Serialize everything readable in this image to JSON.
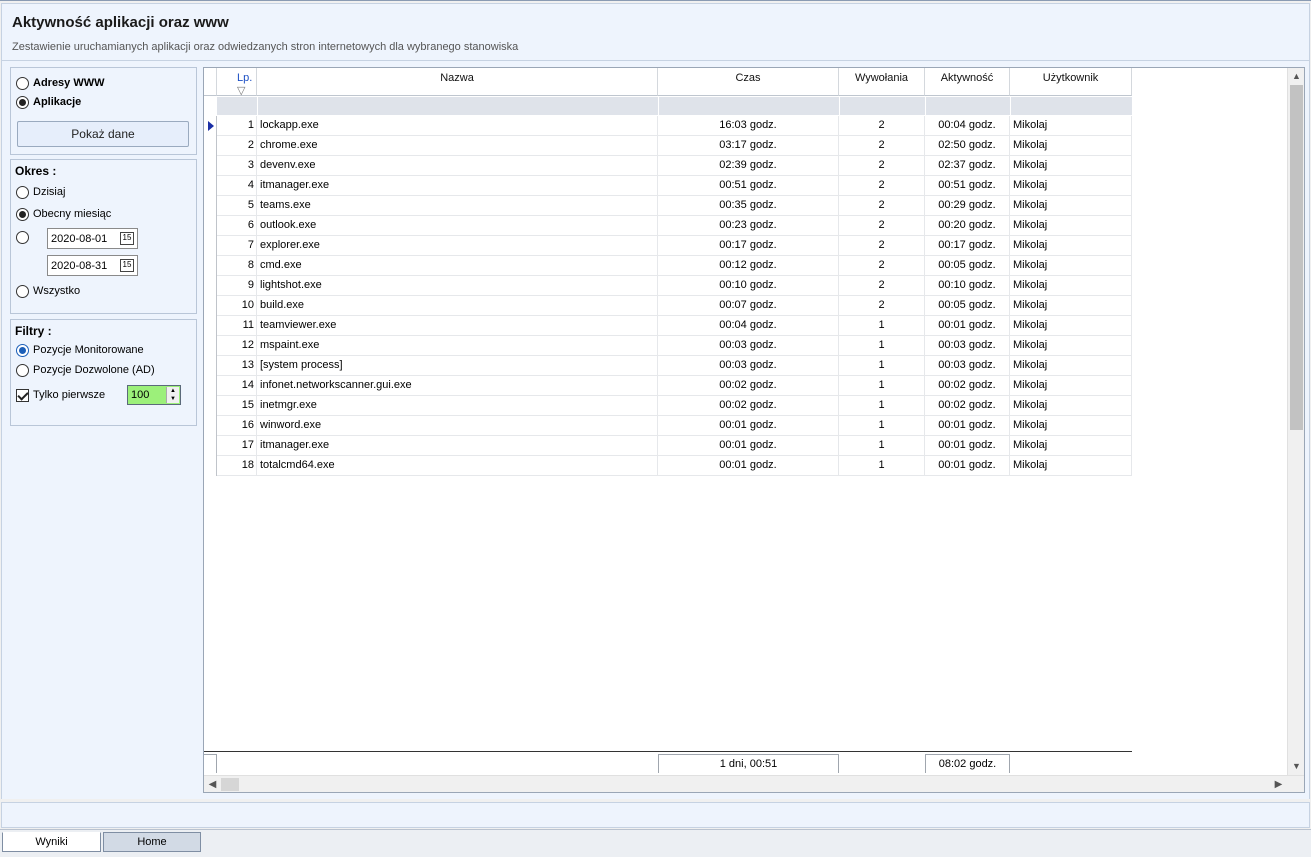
{
  "header": {
    "title": "Aktywność aplikacji oraz www",
    "subtitle": "Zestawienie uruchamianych aplikacji oraz odwiedzanych stron internetowych dla wybranego stanowiska"
  },
  "source": {
    "option_www": "Adresy WWW",
    "option_apps": "Aplikacje",
    "selected": "Aplikacje",
    "show_button": "Pokaż dane"
  },
  "period": {
    "title": "Okres :",
    "today": "Dzisiaj",
    "current_month": "Obecny miesiąc",
    "date_from": "2020-08-01",
    "date_to": "2020-08-31",
    "all": "Wszystko",
    "selected": "Obecny miesiąc"
  },
  "filters": {
    "title": "Filtry :",
    "monitored": "Pozycje Monitorowane",
    "allowed": "Pozycje Dozwolone (AD)",
    "selected": "Pozycje Monitorowane",
    "only_first_label": "Tylko pierwsze",
    "only_first_checked": true,
    "only_first_value": "100"
  },
  "table": {
    "columns": {
      "lp": "Lp.",
      "nazwa": "Nazwa",
      "czas": "Czas",
      "wywolania": "Wywołania",
      "aktywnosc": "Aktywność",
      "uzytkownik": "Użytkownik"
    },
    "rows": [
      {
        "lp": "1",
        "nazwa": "lockapp.exe",
        "czas": "16:03 godz.",
        "wywolania": "2",
        "aktywnosc": "00:04 godz.",
        "uzytkownik": "Mikolaj"
      },
      {
        "lp": "2",
        "nazwa": "chrome.exe",
        "czas": "03:17 godz.",
        "wywolania": "2",
        "aktywnosc": "02:50 godz.",
        "uzytkownik": "Mikolaj"
      },
      {
        "lp": "3",
        "nazwa": "devenv.exe",
        "czas": "02:39 godz.",
        "wywolania": "2",
        "aktywnosc": "02:37 godz.",
        "uzytkownik": "Mikolaj"
      },
      {
        "lp": "4",
        "nazwa": "itmanager.exe",
        "czas": "00:51 godz.",
        "wywolania": "2",
        "aktywnosc": "00:51 godz.",
        "uzytkownik": "Mikolaj"
      },
      {
        "lp": "5",
        "nazwa": "teams.exe",
        "czas": "00:35 godz.",
        "wywolania": "2",
        "aktywnosc": "00:29 godz.",
        "uzytkownik": "Mikolaj"
      },
      {
        "lp": "6",
        "nazwa": "outlook.exe",
        "czas": "00:23 godz.",
        "wywolania": "2",
        "aktywnosc": "00:20 godz.",
        "uzytkownik": "Mikolaj"
      },
      {
        "lp": "7",
        "nazwa": "explorer.exe",
        "czas": "00:17 godz.",
        "wywolania": "2",
        "aktywnosc": "00:17 godz.",
        "uzytkownik": "Mikolaj"
      },
      {
        "lp": "8",
        "nazwa": "cmd.exe",
        "czas": "00:12 godz.",
        "wywolania": "2",
        "aktywnosc": "00:05 godz.",
        "uzytkownik": "Mikolaj"
      },
      {
        "lp": "9",
        "nazwa": "lightshot.exe",
        "czas": "00:10 godz.",
        "wywolania": "2",
        "aktywnosc": "00:10 godz.",
        "uzytkownik": "Mikolaj"
      },
      {
        "lp": "10",
        "nazwa": "build.exe",
        "czas": "00:07 godz.",
        "wywolania": "2",
        "aktywnosc": "00:05 godz.",
        "uzytkownik": "Mikolaj"
      },
      {
        "lp": "11",
        "nazwa": "teamviewer.exe",
        "czas": "00:04 godz.",
        "wywolania": "1",
        "aktywnosc": "00:01 godz.",
        "uzytkownik": "Mikolaj"
      },
      {
        "lp": "12",
        "nazwa": "mspaint.exe",
        "czas": "00:03 godz.",
        "wywolania": "1",
        "aktywnosc": "00:03 godz.",
        "uzytkownik": "Mikolaj"
      },
      {
        "lp": "13",
        "nazwa": "[system process]",
        "czas": "00:03 godz.",
        "wywolania": "1",
        "aktywnosc": "00:03 godz.",
        "uzytkownik": "Mikolaj"
      },
      {
        "lp": "14",
        "nazwa": "infonet.networkscanner.gui.exe",
        "czas": "00:02 godz.",
        "wywolania": "1",
        "aktywnosc": "00:02 godz.",
        "uzytkownik": "Mikolaj"
      },
      {
        "lp": "15",
        "nazwa": "inetmgr.exe",
        "czas": "00:02 godz.",
        "wywolania": "1",
        "aktywnosc": "00:02 godz.",
        "uzytkownik": "Mikolaj"
      },
      {
        "lp": "16",
        "nazwa": "winword.exe",
        "czas": "00:01 godz.",
        "wywolania": "1",
        "aktywnosc": "00:01 godz.",
        "uzytkownik": "Mikolaj"
      },
      {
        "lp": "17",
        "nazwa": "itmanager.exe",
        "czas": "00:01 godz.",
        "wywolania": "1",
        "aktywnosc": "00:01 godz.",
        "uzytkownik": "Mikolaj"
      },
      {
        "lp": "18",
        "nazwa": "totalcmd64.exe",
        "czas": "00:01 godz.",
        "wywolania": "1",
        "aktywnosc": "00:01 godz.",
        "uzytkownik": "Mikolaj"
      }
    ],
    "summary": {
      "czas_total": "1 dni, 00:51",
      "aktywnosc_total": "08:02 godz."
    }
  },
  "tabs": [
    {
      "label": "Wyniki",
      "active": true
    },
    {
      "label": "Home",
      "active": false
    }
  ],
  "colors": {
    "header_bg": "#eef4fd",
    "accent": "#1c5fb8",
    "spin_bg": "#9cf07a",
    "current_row_marker": "#1b2fa6"
  }
}
